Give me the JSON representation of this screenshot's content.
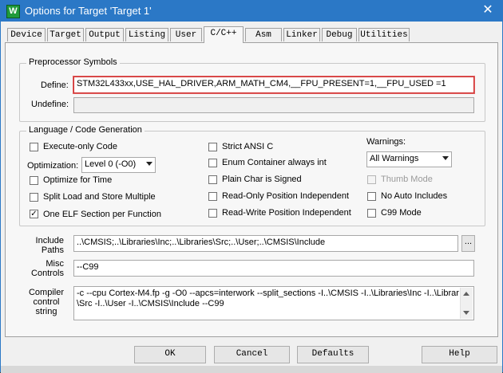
{
  "window": {
    "title": "Options for Target 'Target 1'",
    "icon": "W",
    "close": "✕"
  },
  "tabs": [
    "Device",
    "Target",
    "Output",
    "Listing",
    "User",
    "C/C++",
    "Asm",
    "Linker",
    "Debug",
    "Utilities"
  ],
  "active_tab": "C/C++",
  "preprocessor": {
    "group_label": "Preprocessor Symbols",
    "define_label": "Define:",
    "define_value": "STM32L433xx,USE_HAL_DRIVER,ARM_MATH_CM4,__FPU_PRESENT=1,__FPU_USED =1",
    "undefine_label": "Undefine:",
    "undefine_value": ""
  },
  "language": {
    "group_label": "Language / Code Generation",
    "execute_only": {
      "label": "Execute-only Code",
      "checked": false
    },
    "optimization_label": "Optimization:",
    "optimization_value": "Level 0 (-O0)",
    "optimize_time": {
      "label": "Optimize for Time",
      "checked": false
    },
    "split_load": {
      "label": "Split Load and Store Multiple",
      "checked": false
    },
    "one_elf": {
      "label": "One ELF Section per Function",
      "checked": true,
      "mark": "✓"
    },
    "strict_ansi": {
      "label": "Strict ANSI C",
      "checked": false
    },
    "enum_container": {
      "label": "Enum Container always int",
      "checked": false
    },
    "plain_char": {
      "label": "Plain Char is Signed",
      "checked": false
    },
    "ro_pi": {
      "label": "Read-Only Position Independent",
      "checked": false
    },
    "rw_pi": {
      "label": "Read-Write Position Independent",
      "checked": false
    },
    "warnings_label": "Warnings:",
    "warnings_value": "All Warnings",
    "thumb_mode": {
      "label": "Thumb Mode",
      "checked": false,
      "disabled": true
    },
    "no_auto_includes": {
      "label": "No Auto Includes",
      "checked": false
    },
    "c99_mode": {
      "label": "C99 Mode",
      "checked": false
    }
  },
  "include_paths": {
    "label_line1": "Include",
    "label_line2": "Paths",
    "value": "..\\CMSIS;..\\Libraries\\Inc;..\\Libraries\\Src;..\\User;..\\CMSIS\\Include",
    "browse_label": "..."
  },
  "misc_controls": {
    "label_line1": "Misc",
    "label_line2": "Controls",
    "value": "--C99"
  },
  "compiler_string": {
    "label_line1": "Compiler",
    "label_line2": "control",
    "label_line3": "string",
    "line1": "-c --cpu Cortex-M4.fp -g -O0 --apcs=interwork --split_sections -I..\\CMSIS -I..\\Libraries\\Inc -I..\\Libraries",
    "line2": "\\Src -I..\\User -I..\\CMSIS\\Include --C99"
  },
  "buttons": {
    "ok": "OK",
    "cancel": "Cancel",
    "defaults": "Defaults",
    "help": "Help"
  }
}
